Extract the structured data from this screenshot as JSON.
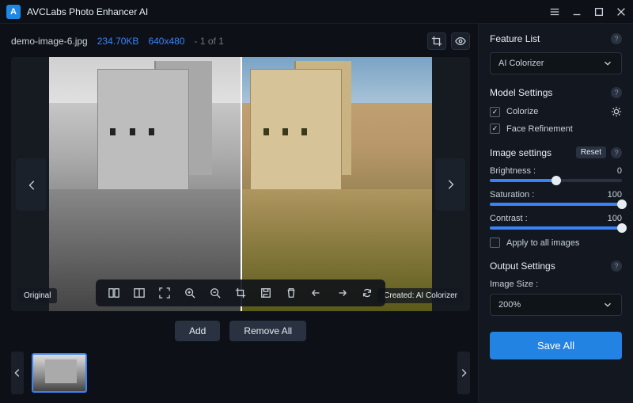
{
  "app": {
    "title": "AVCLabs Photo Enhancer AI"
  },
  "file": {
    "name": "demo-image-6.jpg",
    "size": "234.70KB",
    "dims": "640x480",
    "index": "- 1 of 1"
  },
  "preview": {
    "original_label": "Original",
    "created_label": "Created: AI Colorizer"
  },
  "actions": {
    "add": "Add",
    "remove_all": "Remove All",
    "save_all": "Save All"
  },
  "feature": {
    "header": "Feature List",
    "selected": "AI Colorizer"
  },
  "model": {
    "header": "Model Settings",
    "colorize": {
      "label": "Colorize",
      "checked": true
    },
    "face": {
      "label": "Face Refinement",
      "checked": true
    }
  },
  "image_settings": {
    "header": "Image settings",
    "reset": "Reset",
    "brightness": {
      "label": "Brightness :",
      "value": "0",
      "pct": 50
    },
    "saturation": {
      "label": "Saturation :",
      "value": "100",
      "pct": 100
    },
    "contrast": {
      "label": "Contrast :",
      "value": "100",
      "pct": 100
    },
    "apply_all": {
      "label": "Apply to all images",
      "checked": false
    }
  },
  "output": {
    "header": "Output Settings",
    "image_size_label": "Image Size :",
    "image_size": "200%"
  }
}
